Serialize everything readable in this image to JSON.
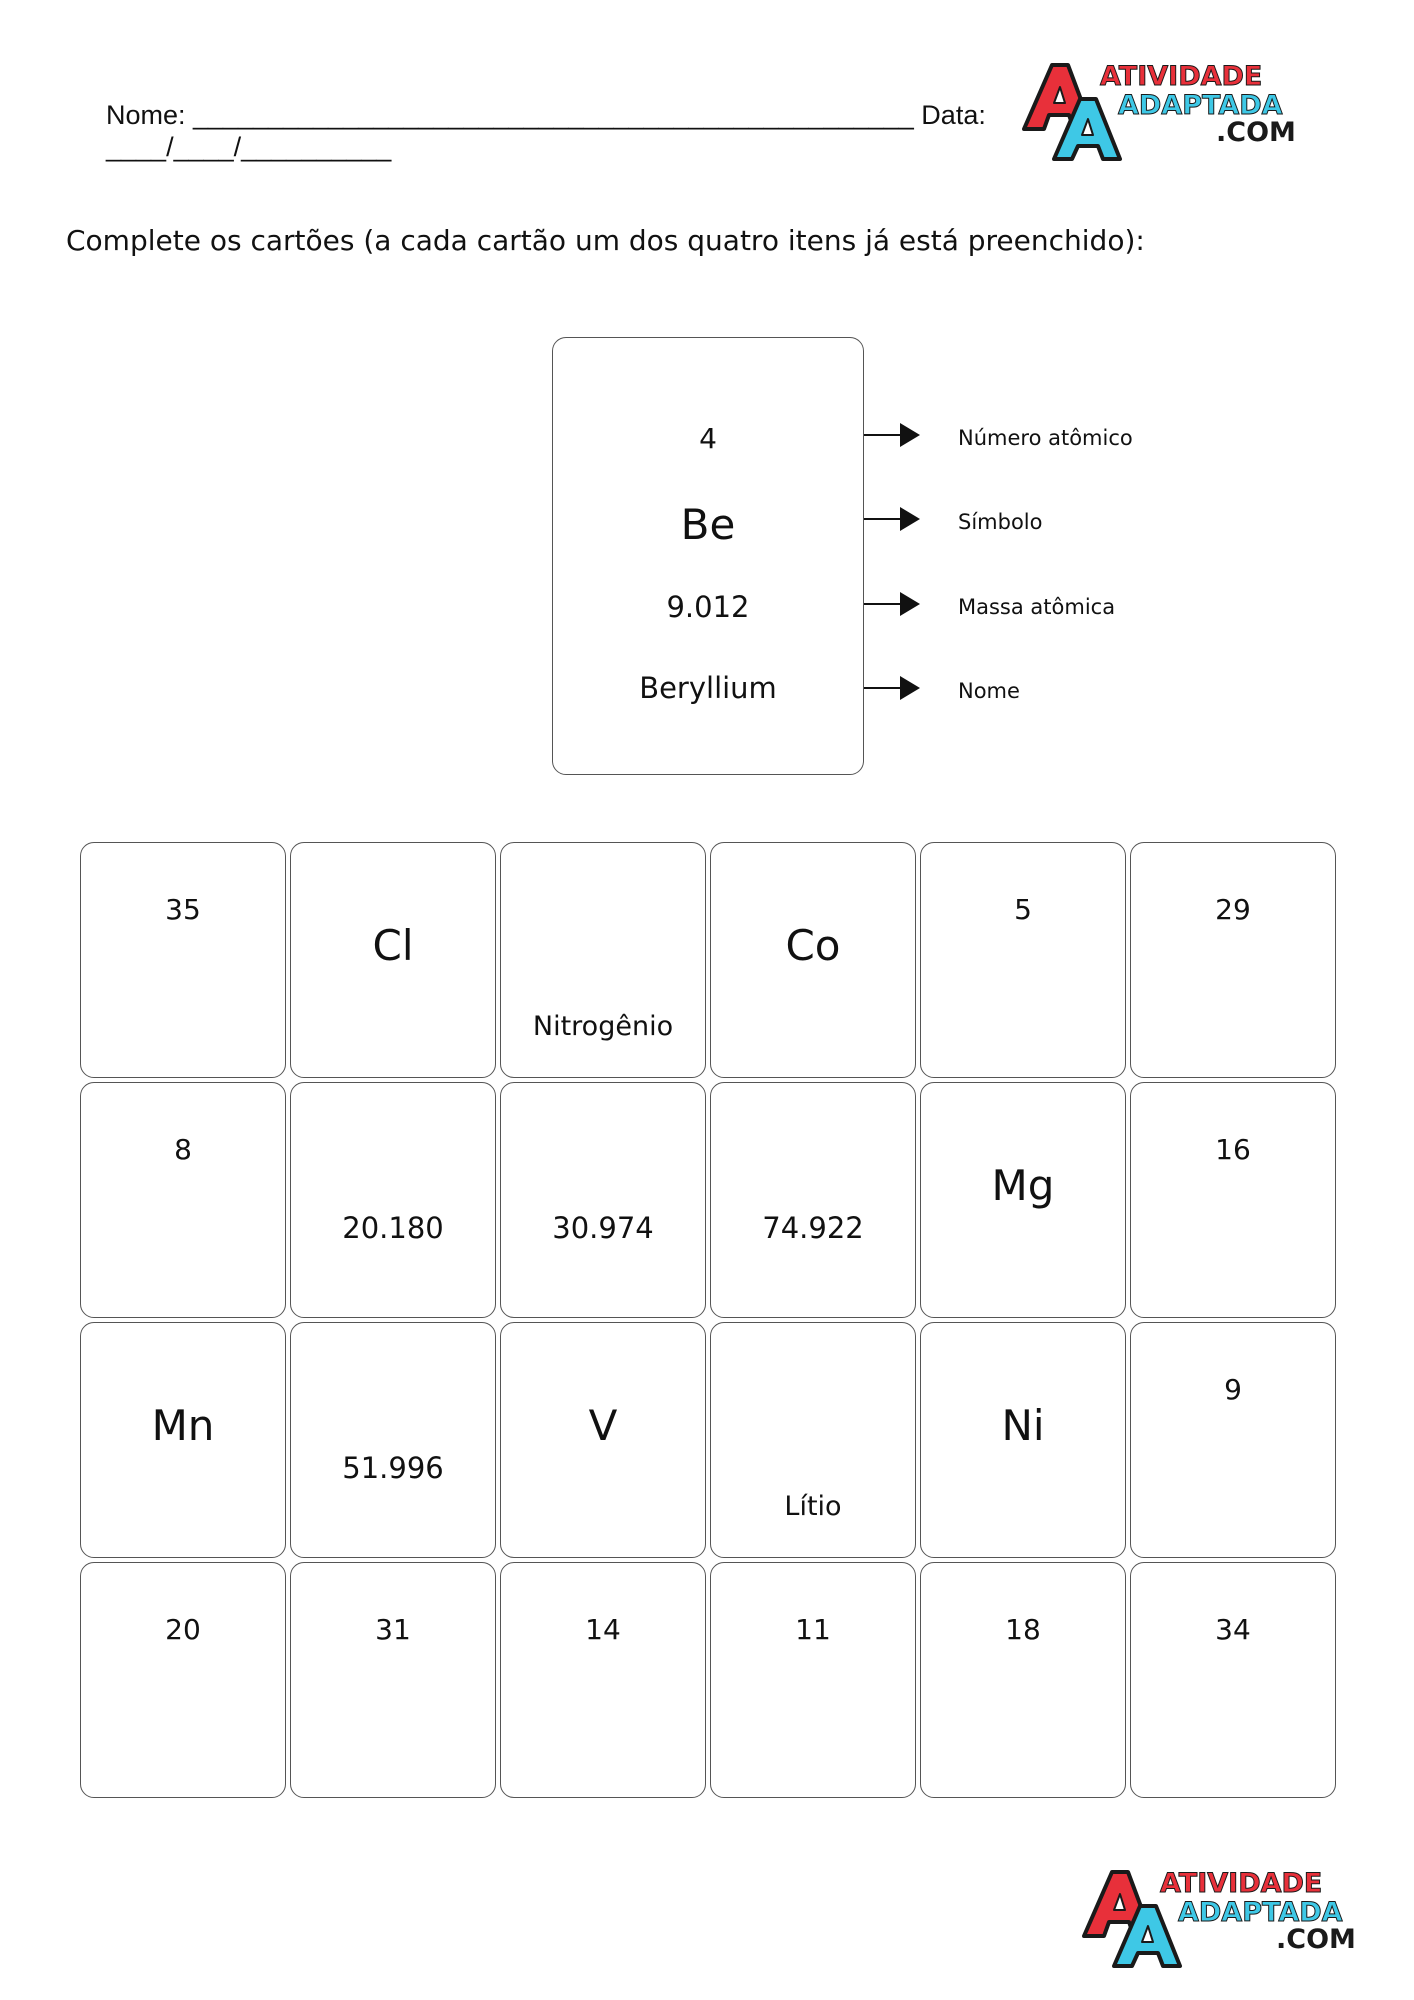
{
  "header": {
    "name_line": "Nome: ________________________________________________ Data:",
    "date_line": "____/____/__________"
  },
  "logo": {
    "letters": "AA",
    "text_line1": "ATIVIDADE",
    "text_line2": "ADAPTADA",
    "text_line3": ".COM",
    "colors": {
      "red": "#e8303a",
      "cyan": "#3ec8e6",
      "dark": "#1a1a1a"
    }
  },
  "instruction": "Complete os cartões (a cada cartão um dos quatro itens já está preenchido):",
  "example": {
    "number": "4",
    "symbol": "Be",
    "mass": "9.012",
    "name": "Beryllium",
    "labels": [
      "Número atômico",
      "Símbolo",
      "Massa atômica",
      "Nome"
    ]
  },
  "cards": [
    {
      "field": "num",
      "text": "35"
    },
    {
      "field": "sym",
      "text": "Cl"
    },
    {
      "field": "name",
      "text": "Nitrogênio"
    },
    {
      "field": "sym",
      "text": "Co"
    },
    {
      "field": "num",
      "text": "5"
    },
    {
      "field": "num",
      "text": "29"
    },
    {
      "field": "num",
      "text": "8"
    },
    {
      "field": "mass",
      "text": "20.180"
    },
    {
      "field": "mass",
      "text": "30.974"
    },
    {
      "field": "mass",
      "text": "74.922"
    },
    {
      "field": "sym",
      "text": "Mg"
    },
    {
      "field": "num",
      "text": "16"
    },
    {
      "field": "sym",
      "text": "Mn"
    },
    {
      "field": "mass",
      "text": "51.996"
    },
    {
      "field": "sym",
      "text": "V"
    },
    {
      "field": "name",
      "text": "Lítio"
    },
    {
      "field": "sym",
      "text": "Ni"
    },
    {
      "field": "num",
      "text": "9"
    },
    {
      "field": "num",
      "text": "20"
    },
    {
      "field": "num",
      "text": "31"
    },
    {
      "field": "num",
      "text": "14"
    },
    {
      "field": "num",
      "text": "11"
    },
    {
      "field": "num",
      "text": "18"
    },
    {
      "field": "num",
      "text": "34"
    }
  ]
}
